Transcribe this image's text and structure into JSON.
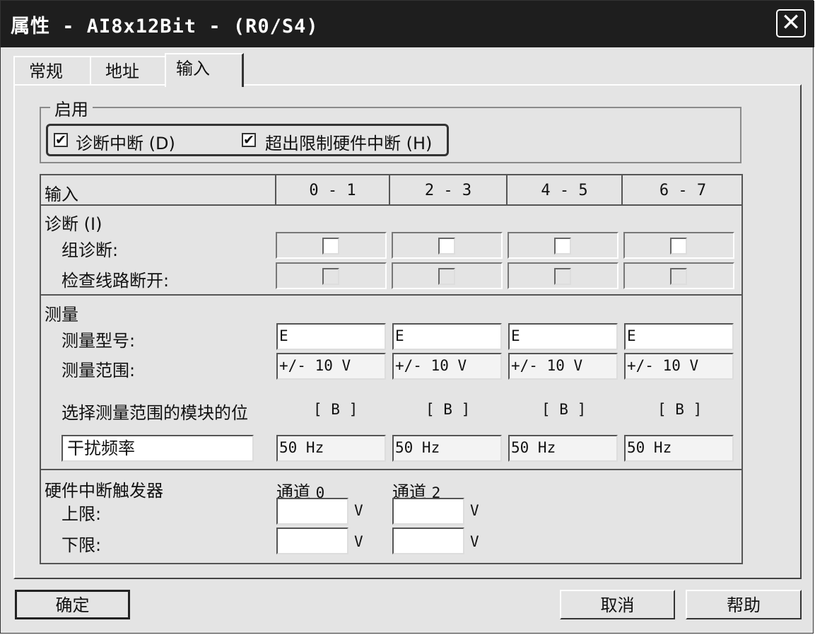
{
  "window": {
    "title": "属性 - AI8x12Bit - (R0/S4)",
    "close_glyph": "✕"
  },
  "tabs": [
    {
      "label": "常规",
      "active": false
    },
    {
      "label": "地址",
      "active": false
    },
    {
      "label": "输入",
      "active": true
    }
  ],
  "enable": {
    "title": "启用",
    "diag_interrupt": {
      "label": "诊断中断 (D)",
      "checked": true,
      "check_glyph": "✔"
    },
    "limit_interrupt": {
      "label": "超出限制硬件中断 (H)",
      "checked": true,
      "check_glyph": "✔"
    }
  },
  "table": {
    "input_header": "输入",
    "channels": [
      "0 - 1",
      "2 - 3",
      "4 - 5",
      "6 - 7"
    ],
    "diagnostics": {
      "title": "诊断 (I)",
      "group_diag": {
        "label": "组诊断:",
        "values": [
          false,
          false,
          false,
          false
        ],
        "enabled": true
      },
      "wire_break": {
        "label": "检查线路断开:",
        "values": [
          false,
          false,
          false,
          false
        ],
        "enabled": false
      }
    },
    "measurement": {
      "title": "测量",
      "type_label": "测量型号:",
      "types": [
        "E",
        "E",
        "E",
        "E"
      ],
      "range_label": "测量范围:",
      "ranges": [
        "+/- 10 V",
        "+/- 10 V",
        "+/- 10 V",
        "+/- 10 V"
      ],
      "module_pos_label": "选择测量范围的模块的位",
      "module_pos": [
        "[ B ]",
        "[ B ]",
        "[ B ]",
        "[ B ]"
      ],
      "interference_label": "干扰频率",
      "interference": [
        "50 Hz",
        "50 Hz",
        "50 Hz",
        "50 Hz"
      ]
    },
    "hw_interrupt": {
      "title": "硬件中断触发器",
      "channel_prefix": "通道",
      "channels": [
        "0",
        "2"
      ],
      "upper_label": "上限:",
      "lower_label": "下限:",
      "unit": "V",
      "upper": [
        "",
        ""
      ],
      "lower": [
        "",
        ""
      ]
    }
  },
  "buttons": {
    "ok": "确定",
    "cancel": "取消",
    "help": "帮助"
  }
}
